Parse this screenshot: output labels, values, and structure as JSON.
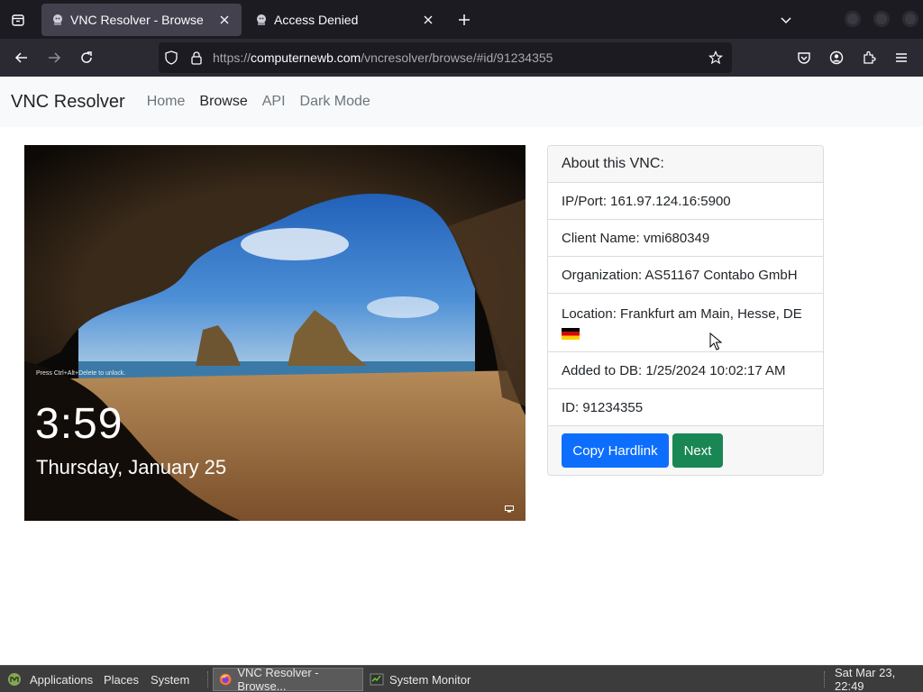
{
  "browser": {
    "tabs": [
      {
        "title": "VNC Resolver - Browse",
        "active": true
      },
      {
        "title": "Access Denied",
        "active": false
      }
    ],
    "url": {
      "scheme": "https://",
      "host": "computernewb.com",
      "path": "/vncresolver/browse/#id/91234355"
    }
  },
  "site": {
    "brand": "VNC Resolver",
    "nav": [
      "Home",
      "Browse",
      "API",
      "Dark Mode"
    ]
  },
  "screenshot": {
    "hint": "Press Ctrl+Alt+Delete to unlock.",
    "time": "3:59",
    "date": "Thursday, January 25"
  },
  "card": {
    "header": "About this VNC:",
    "ip_port": "IP/Port: 161.97.124.16:5900",
    "client_name": "Client Name: vmi680349",
    "organization": "Organization: AS51167 Contabo GmbH",
    "location": "Location: Frankfurt am Main, Hesse, DE",
    "added": "Added to DB: 1/25/2024 10:02:17 AM",
    "id": "ID: 91234355",
    "buttons": {
      "copy": "Copy Hardlink",
      "next": "Next"
    }
  },
  "taskbar": {
    "menus": [
      "Applications",
      "Places",
      "System"
    ],
    "tasks": [
      "VNC Resolver - Browse...",
      "System Monitor"
    ],
    "clock": "Sat Mar 23, 22:49"
  },
  "colors": {
    "primary": "#0d6efd",
    "success": "#198754",
    "browser_bg": "#1c1b22"
  }
}
